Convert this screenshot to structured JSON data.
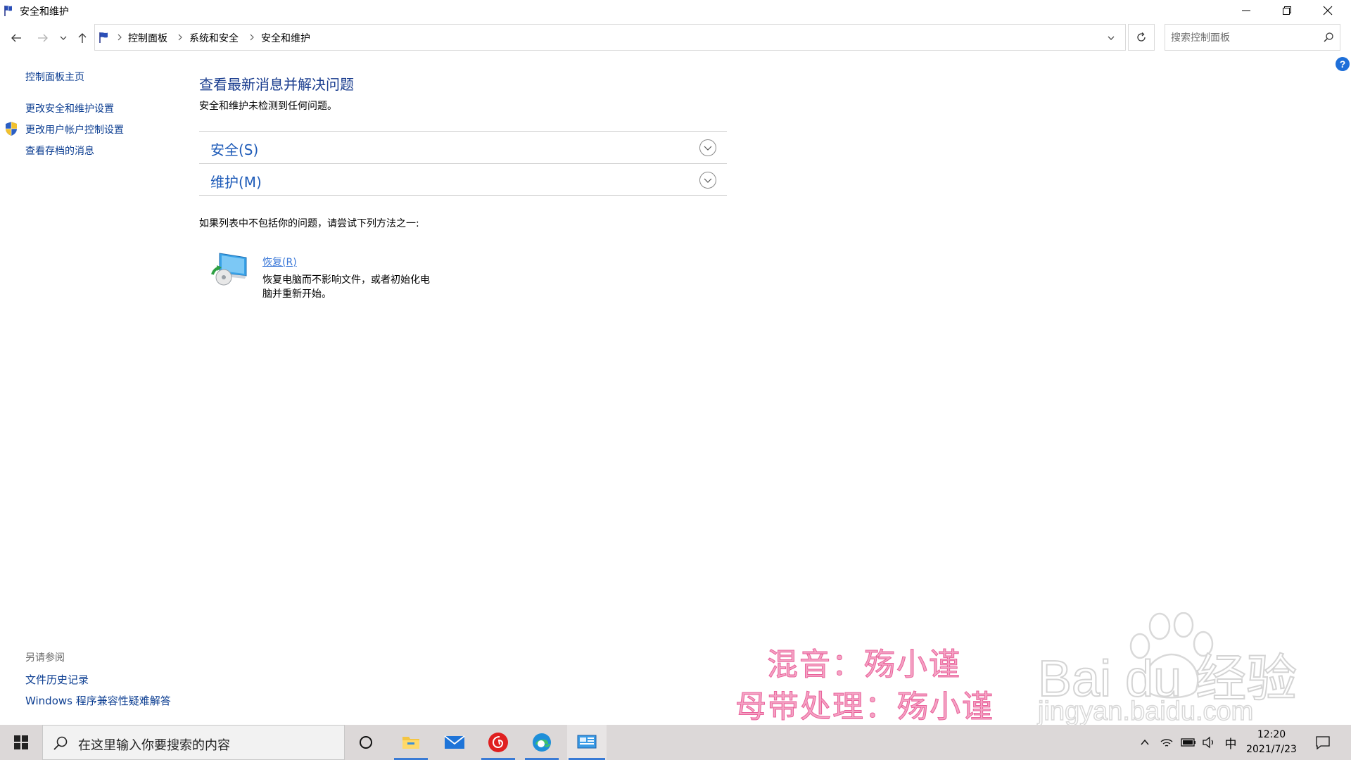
{
  "window": {
    "title": "安全和维护"
  },
  "address": {
    "crumbs": [
      "控制面板",
      "系统和安全",
      "安全和维护"
    ],
    "search_placeholder": "搜索控制面板"
  },
  "left_pane": {
    "links": [
      "控制面板主页",
      "更改安全和维护设置",
      "更改用户帐户控制设置",
      "查看存档的消息"
    ],
    "see_also_heading": "另请参阅",
    "see_also_links": [
      "文件历史记录",
      "Windows 程序兼容性疑难解答"
    ]
  },
  "main": {
    "title": "查看最新消息并解决问题",
    "subtitle": "安全和维护未检测到任何问题。",
    "sections": [
      "安全(S)",
      "维护(M)"
    ],
    "try_text": "如果列表中不包括你的问题，请尝试下列方法之一:",
    "recovery": {
      "link": "恢复(R)",
      "description": "恢复电脑而不影响文件，或者初始化电脑并重新开始。"
    }
  },
  "watermark": {
    "line1": "混音：殇小谨",
    "line2": "母带处理：殇小谨",
    "brand": "Bai  du 经验",
    "url": "jingyan.baidu.com"
  },
  "taskbar": {
    "search_text": "在这里输入你要搜索的内容",
    "ime": "中",
    "time": "12:20",
    "date": "2021/7/23"
  },
  "colors": {
    "link": "#0b3d91",
    "title_blue": "#1a3d8f",
    "section_blue": "#1e5bb8",
    "watermark_pink": "#f4a3c4",
    "taskbar_bg": "#dcd8d8"
  }
}
